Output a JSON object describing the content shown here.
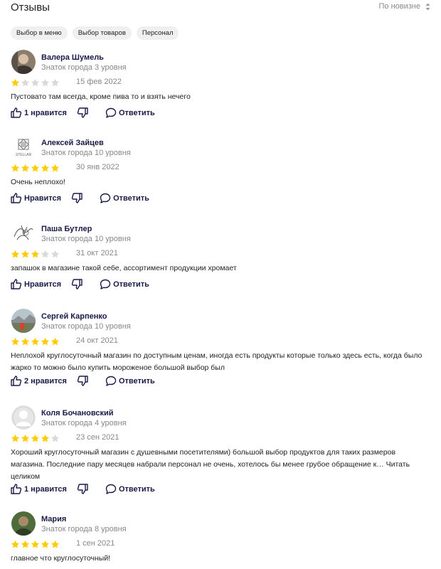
{
  "header": {
    "title": "Отзывы",
    "sort_label": "По новизне"
  },
  "chips": [
    "Выбор в меню",
    "Выбор товаров",
    "Персонал"
  ],
  "colors": {
    "star_filled": "#FFCC00",
    "star_empty": "#D9D9D9",
    "author": "#1A1A4A",
    "muted": "#888888"
  },
  "reviews": [
    {
      "author": "Валера Шумель",
      "level": "Знаток города 3 уровня",
      "rating": 1,
      "date": "15 фев 2022",
      "text": "Пустовато там всегда, кроме пива то и взять нечего",
      "more": "",
      "like": "1 нравится",
      "reply": "Ответить",
      "avatar": "photo-dark"
    },
    {
      "author": "Алексей Зайцев",
      "level": "Знаток города 10 уровня",
      "rating": 5,
      "date": "30 янв 2022",
      "text": "Очень неплохо!",
      "more": "",
      "like": "Нравится",
      "reply": "Ответить",
      "avatar": "logo-stellar",
      "avatar_text": "STELLAR"
    },
    {
      "author": "Паша Бутлер",
      "level": "Знаток города 10 уровня",
      "rating": 3,
      "date": "31 окт 2021",
      "text": "запашок в магазине такой себе, ассортимент продукции хромает",
      "more": "",
      "like": "Нравится",
      "reply": "Ответить",
      "avatar": "sketch"
    },
    {
      "author": "Сергей Карпенко",
      "level": "Знаток города 10 уровня",
      "rating": 5,
      "date": "24 окт 2021",
      "text": "Неплохой круглосуточный магазин по доступным ценам, иногда есть продукты которые только здесь есть, когда было жарко то можно было купить мороженое большой выбор был",
      "more": "",
      "like": "2 нравится",
      "reply": "Ответить",
      "avatar": "photo-landscape"
    },
    {
      "author": "Коля Бочановский",
      "level": "Знаток города 4 уровня",
      "rating": 4,
      "date": "23 сен 2021",
      "text": "Хороший круглосуточный магазин с душевными посетителями) большой выбор продуктов для таких размеров магазина. Последние пару месяцев набрали персонал не очень, хотелось бы менее грубое обращение к…",
      "more": "Читать целиком",
      "like": "1 нравится",
      "reply": "Ответить",
      "avatar": "placeholder-user"
    },
    {
      "author": "Мария",
      "level": "Знаток города 8 уровня",
      "rating": 5,
      "date": "1 сен 2021",
      "text": "главное что круглосуточный!",
      "more": "",
      "like": "",
      "reply": "",
      "avatar": "photo-green"
    }
  ]
}
